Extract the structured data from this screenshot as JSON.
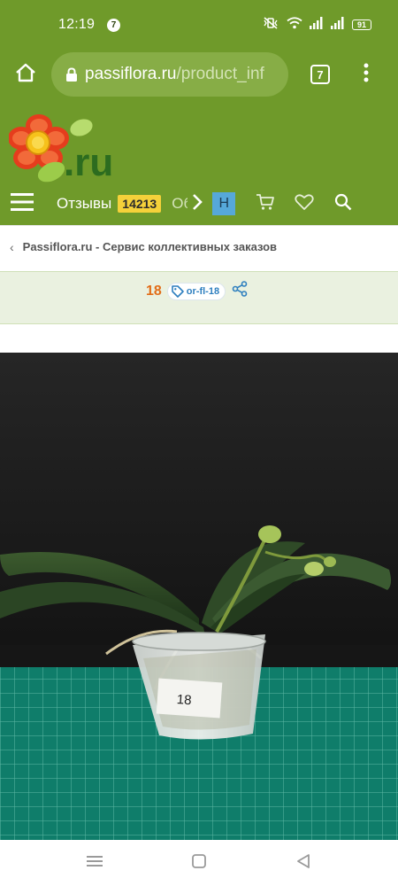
{
  "status_bar": {
    "time": "12:19",
    "notification_count": "7",
    "battery": "91",
    "icons": [
      "mute-vibrate-icon",
      "wifi-icon",
      "signal-icon",
      "signal-icon",
      "battery-icon"
    ]
  },
  "browser": {
    "url_domain": "passiflora.ru",
    "url_path": "/product_inf",
    "tab_count": "7",
    "icons": [
      "home-icon",
      "lock-icon",
      "more-vert-icon"
    ]
  },
  "site_header": {
    "logo_text": ".ru",
    "nav": {
      "reviews_label": "Отзывы",
      "reviews_count": "14213",
      "next_item_partial": "Об",
      "badge_label": "Н"
    },
    "icons": [
      "menu-icon",
      "chevron-right-icon",
      "cart-icon",
      "heart-icon",
      "search-icon"
    ]
  },
  "breadcrumb": {
    "chevron": "‹",
    "text": "Passiflora.ru - Сервис коллективных заказов"
  },
  "product": {
    "number": "18",
    "tag": "or-fl-18",
    "icons": [
      "tag-icon",
      "share-icon"
    ]
  },
  "photo": {
    "pot_label": "18"
  },
  "android_nav": {
    "icons": [
      "recents-icon",
      "home-square-icon",
      "back-triangle-icon"
    ]
  },
  "colors": {
    "brand_green": "#6f9a2a",
    "url_field": "#87ad46",
    "reviews_badge": "#f5d13a",
    "h_badge": "#56a8d9",
    "product_number": "#e26d18",
    "tag_text": "#2e7fbf",
    "product_bar_bg": "#eaf1e0"
  }
}
